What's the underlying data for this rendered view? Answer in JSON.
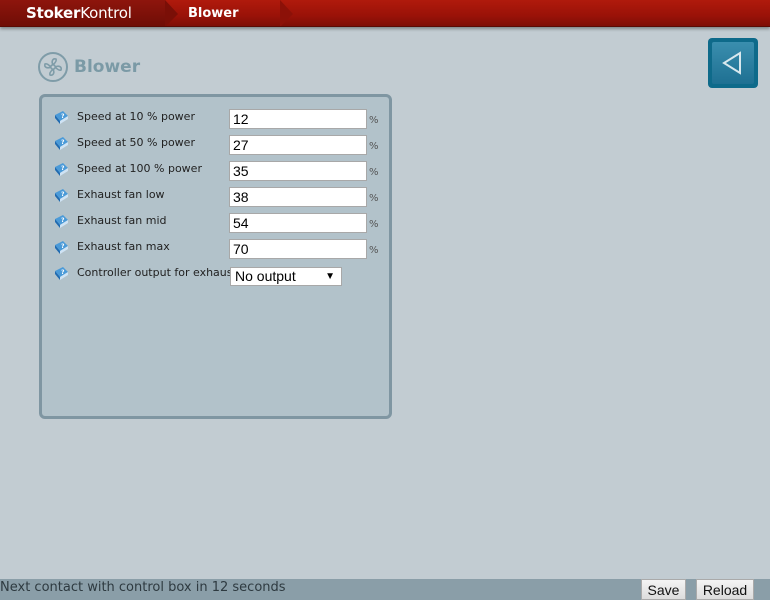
{
  "header": {
    "brand_bold": "Stoker",
    "brand_regular": "Kontrol",
    "breadcrumb_current": "Blower"
  },
  "page": {
    "title": "Blower",
    "title_icon": "fan-icon",
    "back_button_icon": "triangle-left-icon"
  },
  "fields": [
    {
      "label": "Speed at 10 % power",
      "value": "12",
      "unit": "%"
    },
    {
      "label": "Speed at 50 % power",
      "value": "27",
      "unit": "%"
    },
    {
      "label": "Speed at 100 % power",
      "value": "35",
      "unit": "%"
    },
    {
      "label": "Exhaust fan low",
      "value": "38",
      "unit": "%"
    },
    {
      "label": "Exhaust fan mid",
      "value": "54",
      "unit": "%"
    },
    {
      "label": "Exhaust fan max",
      "value": "70",
      "unit": "%"
    }
  ],
  "controller_output": {
    "label": "Controller output for exhaust fan",
    "selected": "No output"
  },
  "status": {
    "text": "Next contact with control box in 12 seconds"
  },
  "buttons": {
    "save": "Save",
    "reload": "Reload"
  },
  "colors": {
    "header_red": "#9a1208",
    "accent_blue": "#0e6a8a",
    "panel_bg": "#b2c2ca",
    "page_bg": "#c2ccd2"
  }
}
